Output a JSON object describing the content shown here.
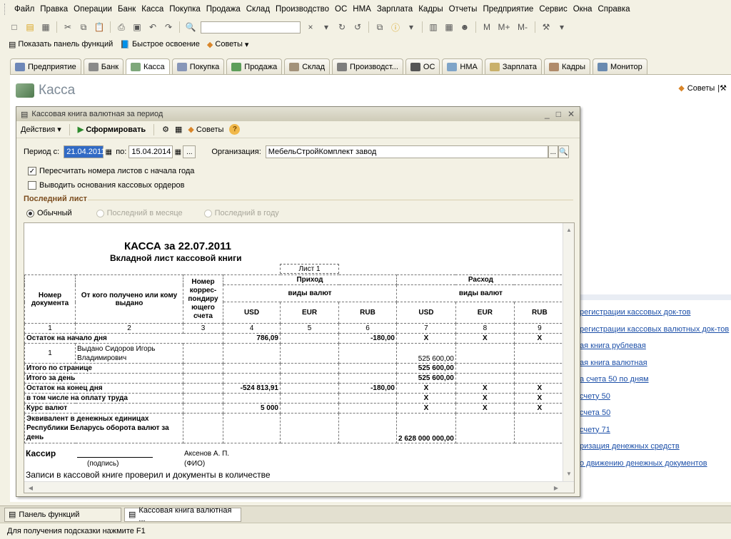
{
  "menu": [
    "Файл",
    "Правка",
    "Операции",
    "Банк",
    "Касса",
    "Покупка",
    "Продажа",
    "Склад",
    "Производство",
    "ОС",
    "НМА",
    "Зарплата",
    "Кадры",
    "Отчеты",
    "Предприятие",
    "Сервис",
    "Окна",
    "Справка"
  ],
  "toolbar2": {
    "show_panel": "Показать панель функций",
    "quick": "Быстрое освоение",
    "tips": "Советы"
  },
  "tabs": [
    "Предприятие",
    "Банк",
    "Касса",
    "Покупка",
    "Продажа",
    "Склад",
    "Производст...",
    "ОС",
    "НМА",
    "Зарплата",
    "Кадры",
    "Монитор"
  ],
  "section_title": "Касса",
  "sovety": "Советы",
  "right_links": [
    "регистрации кассовых док-тов",
    "регистрации кассовых валютных док-тов",
    "ая книга рублевая",
    "ая книга валютная",
    "а счета 50 по дням",
    "счету 50",
    "счета 50",
    "счету 71",
    "ризация денежных средств",
    "о движению денежных документов"
  ],
  "dialog": {
    "title": "Кассовая книга валютная за период",
    "actions": "Действия",
    "generate": "Сформировать",
    "tips": "Советы",
    "period_from_label": "Период с:",
    "period_from": "21.04.2011",
    "period_to_label": "по:",
    "period_to": "15.04.2014",
    "org_label": "Организация:",
    "org": "МебельСтройКомплект завод",
    "cb1": "Пересчитать номера листов с начала года",
    "cb2": "Выводить основания кассовых ордеров",
    "last_sheet": "Последний лист",
    "rb1": "Обычный",
    "rb2": "Последний в месяце",
    "rb3": "Последний в году"
  },
  "report": {
    "title": "КАССА за 22.07.2011",
    "subtitle": "Вкладной лист кассовой книги",
    "sheet": "Лист 1",
    "h_doc": "Номер документа",
    "h_from": "От кого получено или кому выдано",
    "h_corr": "Номер коррес-пондиру ющего счета",
    "h_in": "Приход",
    "h_out": "Расход",
    "h_types": "виды валют",
    "cur": [
      "USD",
      "EUR",
      "RUB"
    ],
    "nums": [
      "1",
      "2",
      "3",
      "4",
      "5",
      "6",
      "7",
      "8",
      "9"
    ],
    "r_start": "Остаток на начало дня",
    "r_start_usd": "786,09",
    "r_start_rub": "-180,00",
    "x": "X",
    "r1_num": "1",
    "r1_name1": "Выдано Сидоров Игорь",
    "r1_name2": "Владимирович",
    "r1_val": "525 600,00",
    "r_page": "Итого по странице",
    "r_page_val": "525 600,00",
    "r_day": "Итого за день",
    "r_day_val": "525 600,00",
    "r_end": "Остаток на конец дня",
    "r_end_usd": "-524 813,91",
    "r_end_rub": "-180,00",
    "r_wage": "в том числе на оплату труда",
    "r_rate": "Курс валют",
    "r_rate_val": "5 000",
    "r_eq1": "Эквивалент в денежных единицах",
    "r_eq2": "Республики Беларусь оборота валют за",
    "r_eq3": "день",
    "r_eq_val": "2 628 000 000,00",
    "cashier": "Кассир",
    "sign": "(подпись)",
    "fio_name": "Аксенов А. П.",
    "fio": "(ФИО)",
    "check": "Записи в кассовой книге проверил и документы в количестве"
  },
  "taskbar": [
    "Панель функций",
    "Кассовая книга валютная ..."
  ],
  "status": "Для получения подсказки нажмите F1"
}
